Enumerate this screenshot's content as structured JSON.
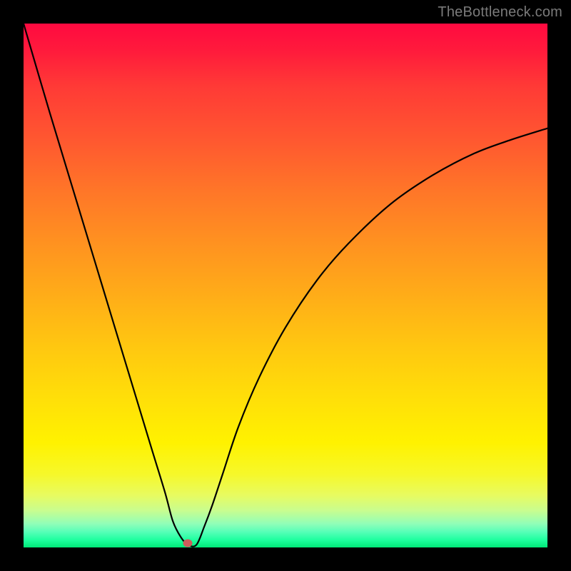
{
  "watermark": "TheBottleneck.com",
  "marker": {
    "x_frac": 0.314,
    "y_frac": 0.992
  },
  "colors": {
    "frame": "#000000",
    "curve": "#000000",
    "marker": "#cd5c5c",
    "watermark": "#7a7a7a"
  },
  "chart_data": {
    "type": "line",
    "title": "",
    "xlabel": "",
    "ylabel": "",
    "xlim": [
      0,
      1
    ],
    "ylim": [
      0,
      1
    ],
    "grid": false,
    "legend": false,
    "annotations": [
      "TheBottleneck.com"
    ],
    "series": [
      {
        "name": "bottleneck-curve",
        "x": [
          0.0,
          0.05,
          0.1,
          0.15,
          0.2,
          0.244,
          0.27,
          0.285,
          0.3,
          0.314,
          0.33,
          0.345,
          0.36,
          0.38,
          0.41,
          0.45,
          0.5,
          0.56,
          0.62,
          0.7,
          0.78,
          0.86,
          0.93,
          1.0
        ],
        "y": [
          1.0,
          0.83,
          0.665,
          0.5,
          0.335,
          0.19,
          0.105,
          0.05,
          0.02,
          0.005,
          0.005,
          0.04,
          0.08,
          0.14,
          0.23,
          0.325,
          0.42,
          0.51,
          0.58,
          0.655,
          0.71,
          0.752,
          0.778,
          0.8
        ]
      }
    ],
    "marker_point": {
      "x": 0.314,
      "y": 0.008
    },
    "gradient_stops": [
      {
        "pos": 0.0,
        "color": "#ff0a40"
      },
      {
        "pos": 0.12,
        "color": "#ff3a36"
      },
      {
        "pos": 0.32,
        "color": "#ff7628"
      },
      {
        "pos": 0.52,
        "color": "#ffad18"
      },
      {
        "pos": 0.72,
        "color": "#ffe008"
      },
      {
        "pos": 0.86,
        "color": "#f6f82a"
      },
      {
        "pos": 0.95,
        "color": "#90feb8"
      },
      {
        "pos": 1.0,
        "color": "#00e878"
      }
    ]
  }
}
